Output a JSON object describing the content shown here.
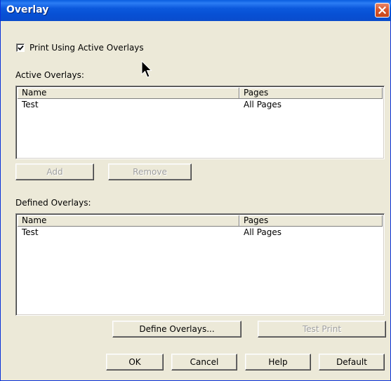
{
  "window": {
    "title": "Overlay"
  },
  "print_option": {
    "label": "Print Using Active Overlays",
    "checked": true
  },
  "active": {
    "label": "Active Overlays:",
    "columns": [
      "Name",
      "Pages"
    ],
    "rows": [
      {
        "name": "Test",
        "pages": "All Pages"
      }
    ]
  },
  "defined": {
    "label": "Defined Overlays:",
    "columns": [
      "Name",
      "Pages"
    ],
    "rows": [
      {
        "name": "Test",
        "pages": "All Pages"
      }
    ]
  },
  "buttons": {
    "add": "Add",
    "remove": "Remove",
    "define": "Define Overlays...",
    "test_print": "Test Print",
    "ok": "OK",
    "cancel": "Cancel",
    "help": "Help",
    "default": "Default"
  },
  "icons": {
    "close": "close-icon",
    "check": "checkmark-icon",
    "cursor": "mouse-pointer-icon"
  },
  "colors": {
    "titlebar": "#0a5fe0",
    "dialog_bg": "#ece9d8",
    "close_button": "#d8572e"
  }
}
